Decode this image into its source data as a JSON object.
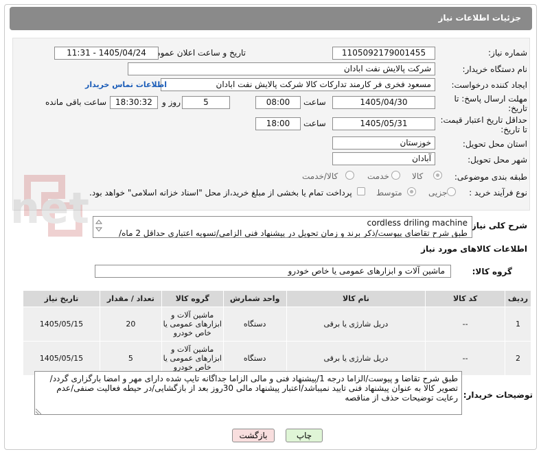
{
  "header": {
    "title": "جزئیات اطلاعات نیاز"
  },
  "form": {
    "need_number": {
      "label": "شماره نیاز:",
      "value": "1105092179001455"
    },
    "announce_datetime": {
      "label": "تاریخ و ساعت اعلان عمومی:",
      "value": "1405/04/24 - 11:31"
    },
    "buyer_org": {
      "label": "نام دستگاه خریدار:",
      "value": "شرکت پالایش نفت ابادان"
    },
    "requester": {
      "label": "ایجاد کننده درخواست:",
      "value": "مسعود فخری فر کارمند تدارکات کالا شرکت پالایش نفت ابادان",
      "contact_link": "اطلاعات تماس خریدار"
    },
    "reply_deadline": {
      "label_line1": "مهلت ارسال پاسخ: تا",
      "label_line2": "تاریخ:",
      "date": "1405/04/30",
      "time_label": "ساعت",
      "time": "08:00",
      "days": "5",
      "days_label": "روز و",
      "remaining": "18:30:32",
      "remaining_label": "ساعت باقی مانده"
    },
    "price_validity": {
      "label_line1": "حداقل تاریخ اعتبار قیمت:",
      "label_line2": "تا تاریخ:",
      "date": "1405/05/31",
      "time_label": "ساعت",
      "time": "18:00"
    },
    "delivery_province": {
      "label": "استان محل تحویل:",
      "value": "خوزستان"
    },
    "delivery_city": {
      "label": "شهر محل تحویل:",
      "value": "آبادان"
    },
    "category": {
      "label": "طبقه بندی موضوعی:",
      "options": [
        "کالا",
        "خدمت",
        "کالا/خدمت"
      ],
      "selected": "کالا"
    },
    "process": {
      "label": "نوع فرآیند خرید :",
      "options": [
        "جزیی",
        "متوسط"
      ],
      "selected": "متوسط",
      "payment_note": "پرداخت تمام یا بخشی از مبلغ خرید،از محل \"اسناد خزانه اسلامی\" خواهد بود."
    }
  },
  "description": {
    "label": "شرح کلی نیاز:",
    "line1": "cordless driling machine",
    "line2": "طبق شرح تقاضای پیوست/ذکر برند و زمان تحویل در پیشنهاد فنی الزامی/تسویه اعتباری حداقل 2 ماه/"
  },
  "goods_info": {
    "title": "اطلاعات کالاهای مورد نیاز",
    "group_label": "گروه کالا:",
    "group_value": "ماشین آلات و ابزارهای عمومی یا خاص خودرو"
  },
  "table": {
    "headers": [
      "ردیف",
      "کد کالا",
      "نام کالا",
      "واحد شمارش",
      "گروه کالا",
      "تعداد / مقدار",
      "تاریخ نیاز"
    ],
    "rows": [
      {
        "row": "1",
        "code": "--",
        "name": "دریل شارژی یا برقی",
        "unit": "دستگاه",
        "group": "ماشین آلات و ابزارهای عمومی یا خاص خودرو",
        "qty": "20",
        "date": "1405/05/15"
      },
      {
        "row": "2",
        "code": "--",
        "name": "دریل شارژی یا برقی",
        "unit": "دستگاه",
        "group": "ماشین آلات و ابزارهای عمومی یا خاص خودرو",
        "qty": "5",
        "date": "1405/05/15"
      }
    ]
  },
  "buyer_notes": {
    "label": "توضیحات خریدار:",
    "text": "طبق شرح تقاضا و پیوست/الزاما درجه 1/پیشنهاد فنی و مالی الزاما جداگانه تایپ شده دارای مهر و امضا بارگزاری گردد/تصویر کالا به عنوان پیشنهاد فنی تایید نمیباشد/اعتبار پیشنهاد مالی 30روز بعد از بازگشایی/در حیطه فعالیت صنفی/عدم رعایت توضیحات حذف از مناقصه"
  },
  "buttons": {
    "print": "چاپ",
    "back": "بازگشت"
  },
  "watermark": {
    "text": "AriaTender.net"
  },
  "colors": {
    "header_bg": "#8a8a8a",
    "link": "#1a5cb8",
    "print_bg": "#dff5d6",
    "back_bg": "#f8dede"
  }
}
